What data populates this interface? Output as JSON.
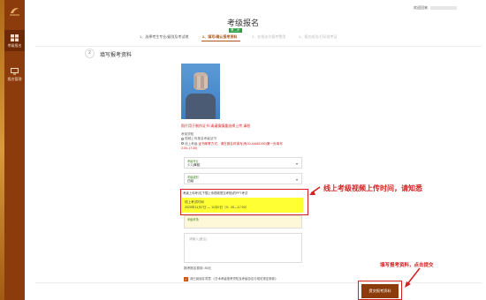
{
  "header": {
    "welcome_text": "欢迎回来,"
  },
  "sidebar": {
    "items": [
      {
        "label": "考级报名",
        "icon": "grid-icon",
        "active": true
      },
      {
        "label": "报名管理",
        "icon": "monitor-icon",
        "active": false
      }
    ]
  },
  "page_title": "考级报名",
  "steps": {
    "badge": "第二步",
    "items": [
      {
        "label": "1、选择考生专业/级别及考试地",
        "state": "done"
      },
      {
        "label": "2、填写/确认报考资料",
        "state": "active"
      },
      {
        "label": "3、在线支付报考费用",
        "state": "pending"
      },
      {
        "label": "4、报名成功/打印准考证",
        "state": "pending"
      }
    ]
  },
  "section": {
    "number": "2",
    "title": "填写报考资料"
  },
  "photo_note": "照片用于制作证书,请谨慎慎重选择上传,请检",
  "exam_info": {
    "heading": "考前须知",
    "option1": "视频上传报名考级证书",
    "option2_prefix": "线上考级:",
    "option2_red": "证书邮寄方式，请在报名时填写(有20-44681000)第一页填写",
    "option2_time": "3:00-17:30)"
  },
  "fields": {
    "field1": {
      "label": "考级专业",
      "value": "少儿舞蹈"
    },
    "field2": {
      "label": "考级级别",
      "value": "四级"
    },
    "field3": {
      "label": "考级考场"
    },
    "remark_placeholder": "请输入(备注)"
  },
  "video_notice": {
    "note": "考级上传考试(下载上传视频提交考核)的PPT考试",
    "title": "线上考试时间",
    "time": "2020年11月7日 — 11月9日（9：00—17:00）"
  },
  "fee_text": "报考报名费用: 85元",
  "agreement_text": "我已阅读并同意 《艺术考级报考须知及考级协议与相关规定条款》",
  "submit_label": "提交报考资料",
  "annotations": {
    "video_upload_time": "线上考级视频上传时间，请知悉",
    "submit_hint": "填写报考资料，点击提交"
  },
  "colors": {
    "brand": "#8c3c0c",
    "highlight": "#ffff33",
    "annotation": "#d21f1f"
  }
}
